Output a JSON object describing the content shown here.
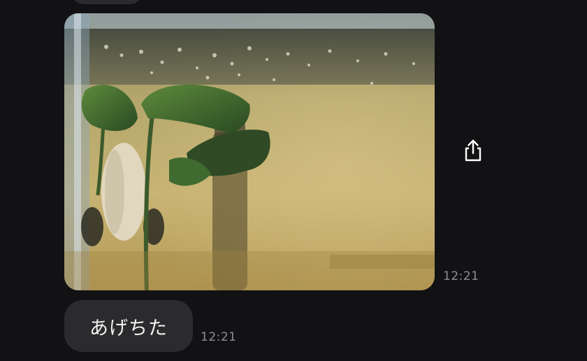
{
  "messages": [
    {
      "type": "image",
      "image_subject": "aquarium-photo",
      "time": "12:21",
      "share_icon": "share-icon"
    },
    {
      "type": "text",
      "text": "あげちた",
      "time": "12:21"
    }
  ],
  "colors": {
    "background": "#121214",
    "bubble": "#2b2b2e",
    "timestamp": "#8e8e93",
    "text": "#f2f2f2"
  }
}
